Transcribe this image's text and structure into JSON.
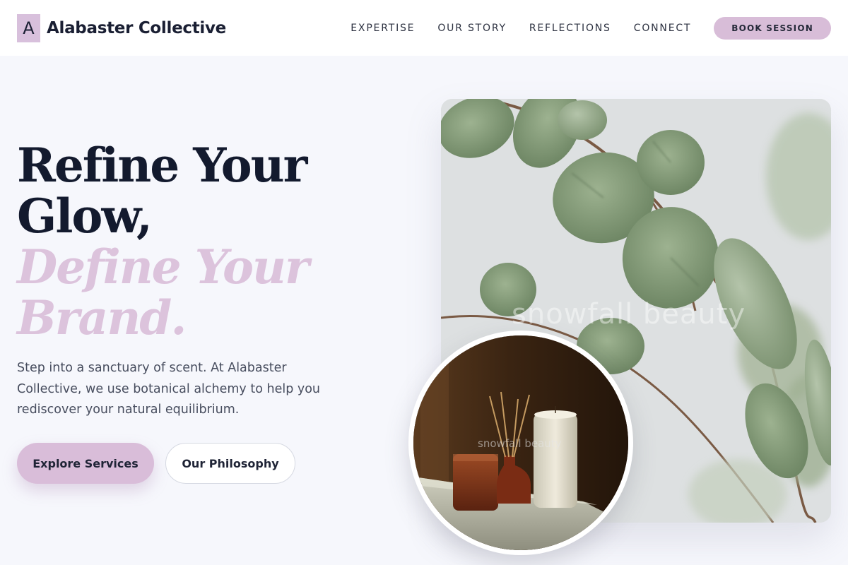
{
  "brand": {
    "mark": "A",
    "name": "Alabaster Collective"
  },
  "nav": {
    "items": [
      "EXPERTISE",
      "OUR STORY",
      "REFLECTIONS",
      "CONNECT"
    ],
    "cta": "BOOK SESSION"
  },
  "hero": {
    "headline_line1": "Refine Your",
    "headline_line2": "Glow,",
    "accent_line1": "Define Your",
    "accent_line2": "Brand.",
    "lead": "Step into a sanctuary of scent. At Alabaster Collective, we use botanical alchemy to help you rediscover your natural equilibrium.",
    "primary_button": "Explore Services",
    "secondary_button": "Our Philosophy"
  },
  "images": {
    "main_watermark": "snowfall beauty",
    "circle_watermark": "snowfall beauty"
  },
  "colors": {
    "accent": "#d9bdd9",
    "heading": "#131a2e",
    "background": "#f6f7fc"
  }
}
